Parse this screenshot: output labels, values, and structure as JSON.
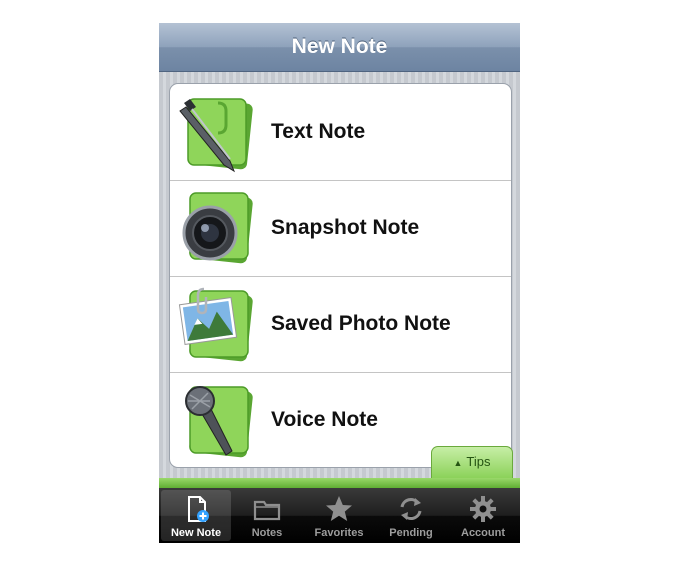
{
  "navbar": {
    "title": "New Note"
  },
  "rows": [
    {
      "label": "Text Note",
      "icon": "pen-icon"
    },
    {
      "label": "Snapshot Note",
      "icon": "camera-icon"
    },
    {
      "label": "Saved Photo Note",
      "icon": "photo-icon"
    },
    {
      "label": "Voice Note",
      "icon": "microphone-icon"
    }
  ],
  "tips": {
    "label": "Tips"
  },
  "tabs": [
    {
      "label": "New Note",
      "icon": "new-note-icon",
      "active": true
    },
    {
      "label": "Notes",
      "icon": "folder-icon"
    },
    {
      "label": "Favorites",
      "icon": "star-icon"
    },
    {
      "label": "Pending",
      "icon": "sync-icon"
    },
    {
      "label": "Account",
      "icon": "gear-icon"
    }
  ],
  "colors": {
    "accent_green": "#6cc23d",
    "nav_blue": "#7b90ab"
  }
}
